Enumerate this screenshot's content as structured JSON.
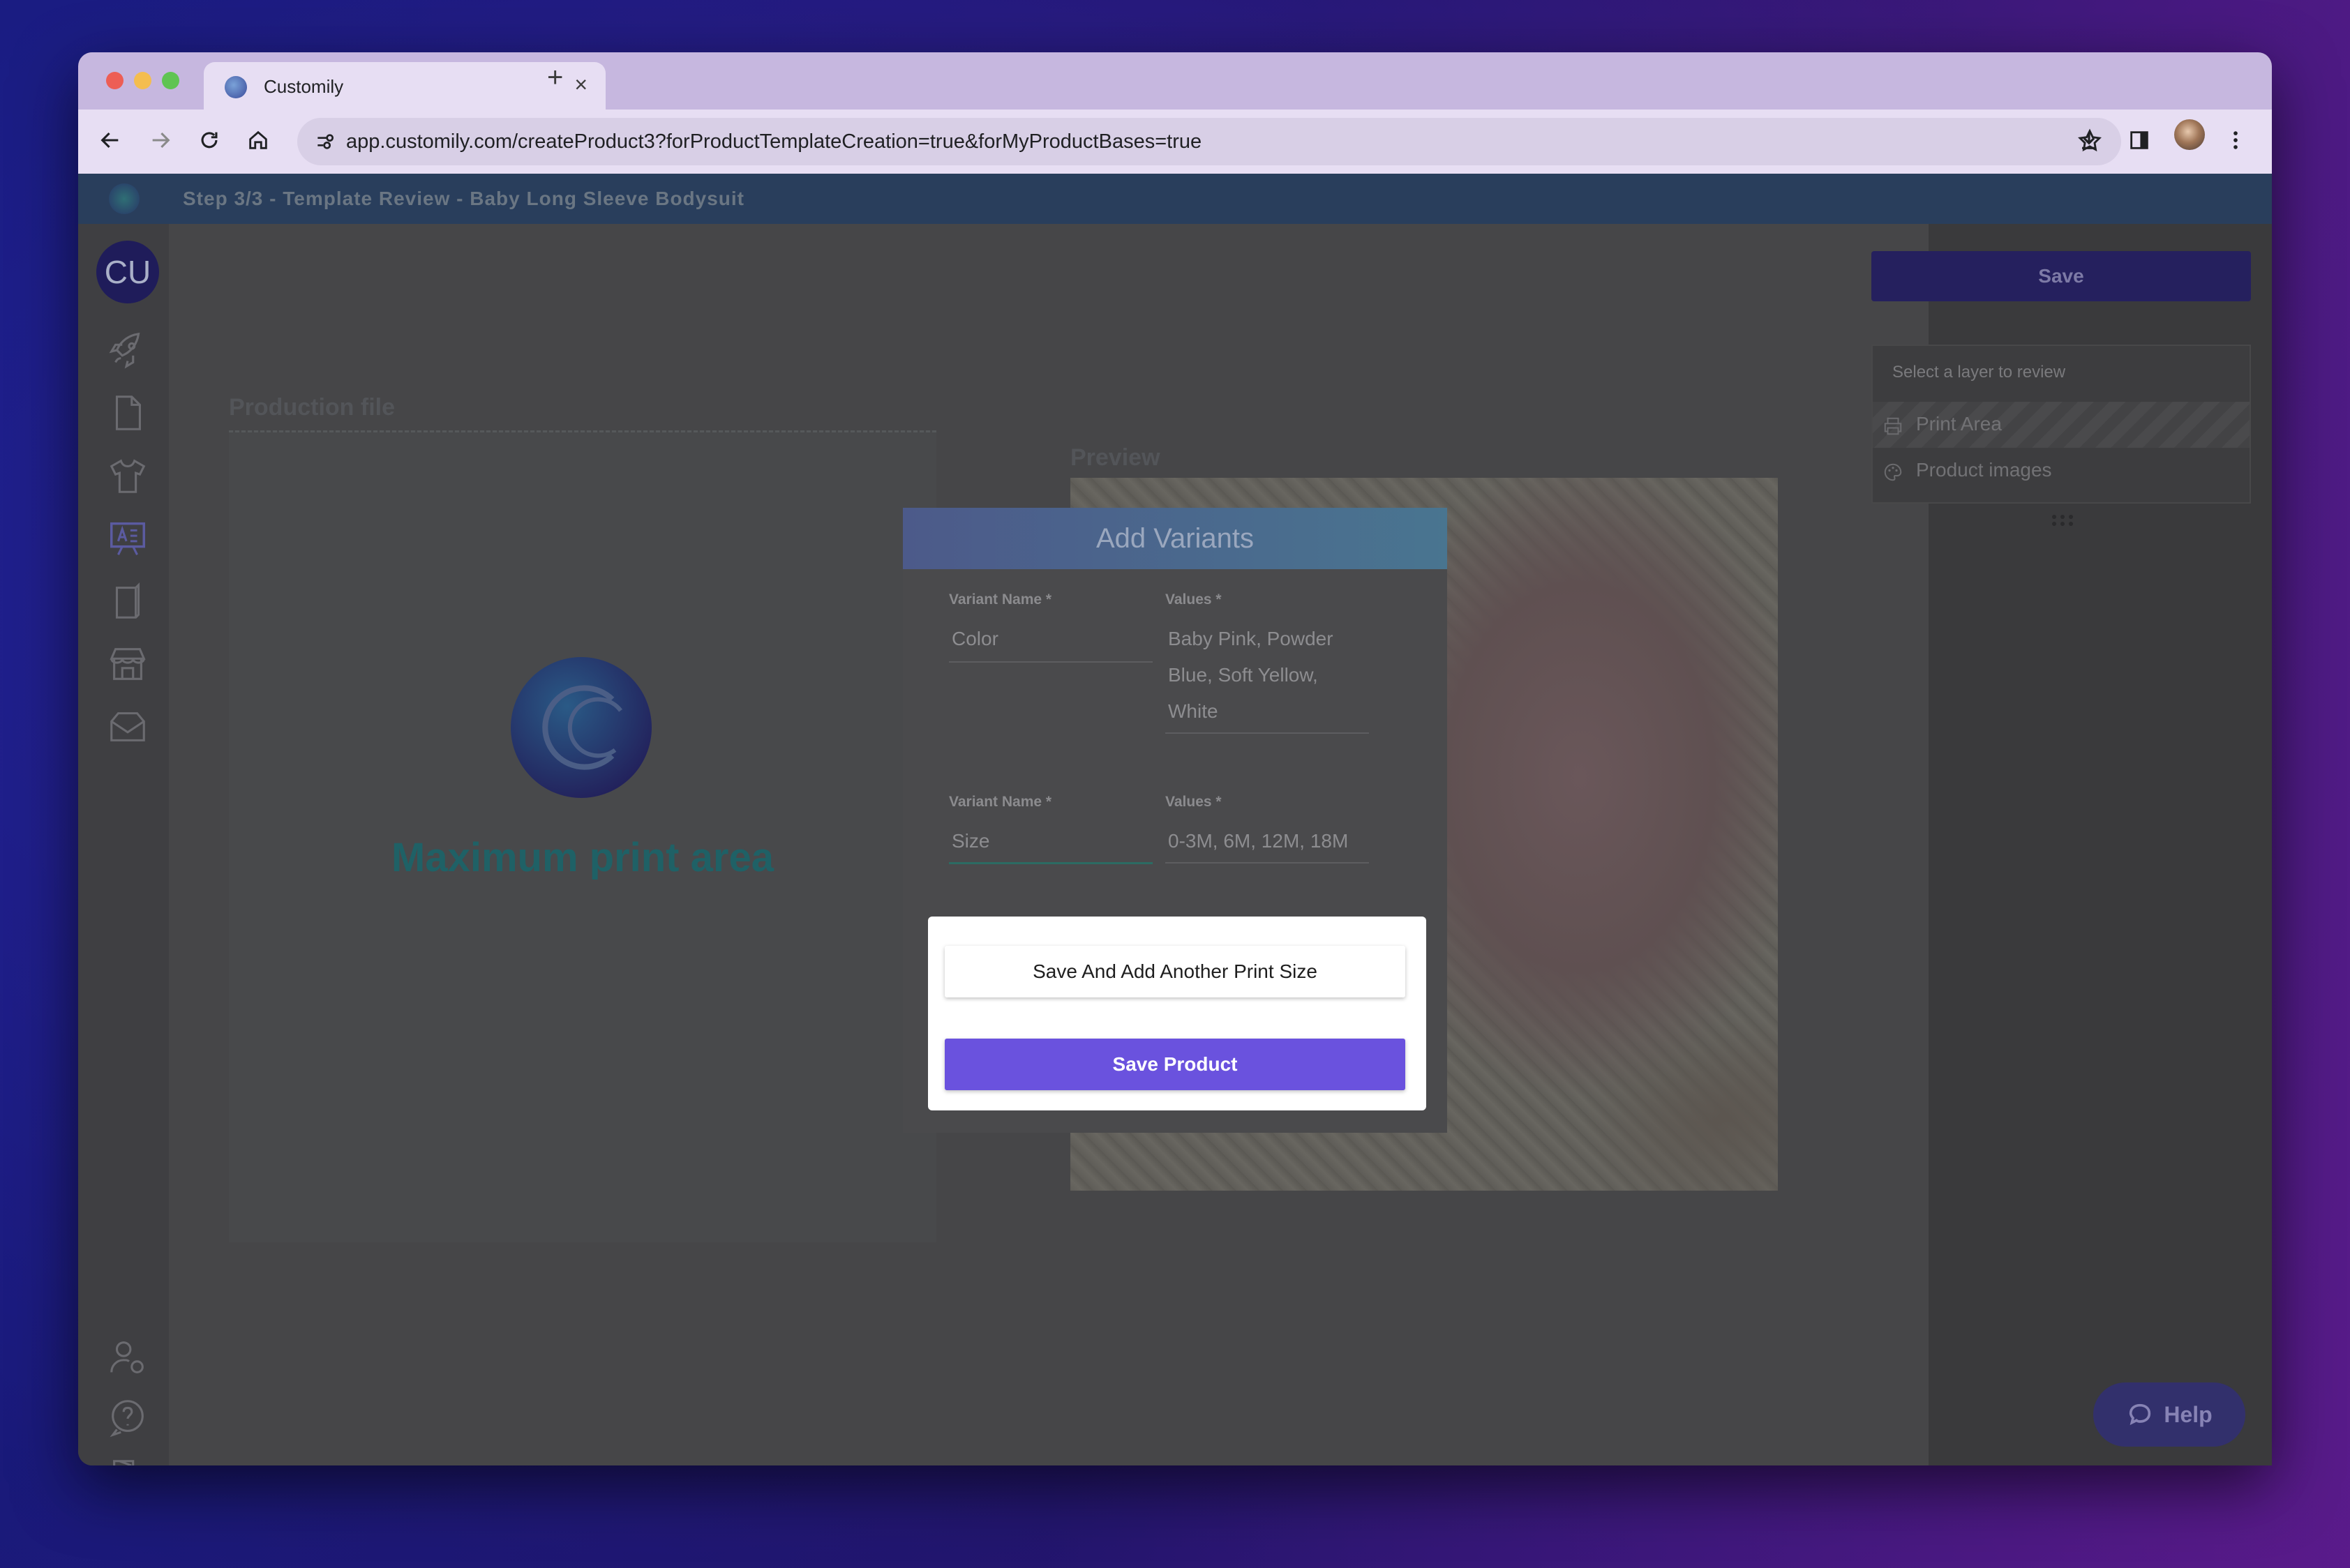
{
  "browser": {
    "tab_title": "Customily",
    "url": "app.customily.com/createProduct3?forProductTemplateCreation=true&forMyProductBases=true"
  },
  "appbar": {
    "title": "Step 3/3 - Template Review - Baby Long Sleeve Bodysuit"
  },
  "sidebar": {
    "avatar_initials": "CU",
    "items": [
      "rocket-icon",
      "document-icon",
      "tshirt-icon",
      "design-board-icon",
      "book-icon",
      "store-icon",
      "inbox-icon",
      "user-settings-icon",
      "help-circle-icon",
      "exit-icon"
    ]
  },
  "canvas": {
    "production_label": "Production file",
    "print_area_text": "Maximum print area",
    "preview_label": "Preview"
  },
  "right_panel": {
    "save_label": "Save",
    "layer_hint": "Select a layer to review",
    "layers": [
      {
        "label": "Print Area",
        "icon": "printer-icon"
      },
      {
        "label": "Product images",
        "icon": "palette-icon"
      }
    ],
    "help_label": "Help"
  },
  "dialog": {
    "title": "Add Variants",
    "variants": [
      {
        "name_label": "Variant Name *",
        "name": "Color",
        "values_label": "Values *",
        "values_lines": [
          "Baby Pink, Powder",
          "Blue, Soft Yellow,",
          "White"
        ]
      },
      {
        "name_label": "Variant Name *",
        "name": "Size",
        "values_label": "Values *",
        "values_lines": [
          "0-3M, 6M, 12M, 18M"
        ]
      }
    ],
    "save_another_label": "Save And Add Another Print Size",
    "save_product_label": "Save Product"
  }
}
